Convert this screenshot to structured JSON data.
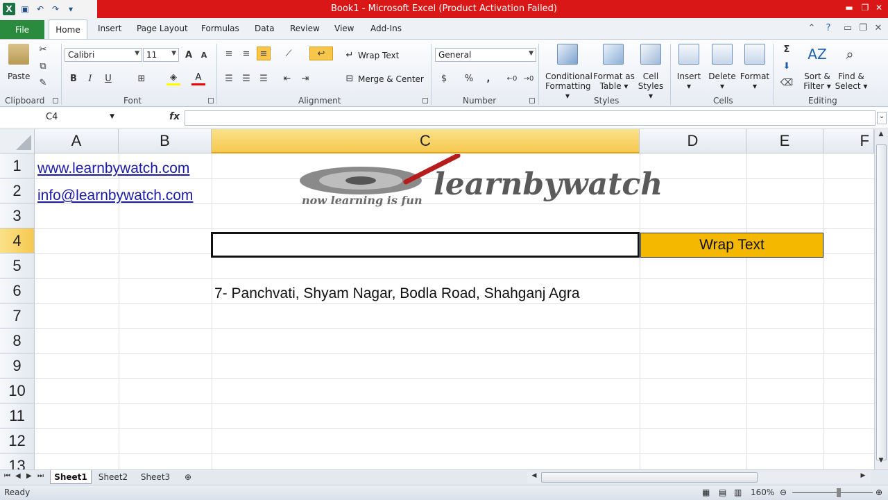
{
  "window": {
    "title": "Book1  -  Microsoft Excel (Product Activation Failed)"
  },
  "qat": {
    "logo": "X",
    "icons": [
      "save-icon",
      "undo-icon",
      "redo-icon",
      "customize-icon"
    ]
  },
  "tabs": {
    "file": "File",
    "home": "Home",
    "insert": "Insert",
    "page_layout": "Page Layout",
    "formulas": "Formulas",
    "data": "Data",
    "review": "Review",
    "view": "View",
    "add_ins": "Add-Ins"
  },
  "ribbon": {
    "clipboard": {
      "paste": "Paste",
      "group": "Clipboard"
    },
    "font": {
      "name": "Calibri",
      "size": "11",
      "group": "Font",
      "bold": "B",
      "italic": "I",
      "underline": "U",
      "grow": "A",
      "shrink": "A"
    },
    "alignment": {
      "wrap_text": "Wrap Text",
      "merge_center": "Merge & Center",
      "group": "Alignment"
    },
    "number": {
      "format": "General",
      "percent": "%",
      "comma": ",",
      "group": "Number"
    },
    "styles": {
      "conditional_1": "Conditional",
      "conditional_2": "Formatting",
      "format_table_1": "Format as",
      "format_table_2": "Table",
      "cell_styles_1": "Cell",
      "cell_styles_2": "Styles",
      "group": "Styles"
    },
    "cells": {
      "insert": "Insert",
      "delete": "Delete",
      "format": "Format",
      "group": "Cells"
    },
    "editing": {
      "sigma": "Σ",
      "sort_1": "Sort &",
      "sort_2": "Filter",
      "find_1": "Find &",
      "find_2": "Select",
      "group": "Editing"
    }
  },
  "formula_bar": {
    "name_box": "C4",
    "fx": "fx",
    "value": ""
  },
  "grid": {
    "columns": [
      "A",
      "B",
      "C",
      "D",
      "E",
      "F"
    ],
    "rows": [
      "1",
      "2",
      "3",
      "4",
      "5",
      "6",
      "7",
      "8",
      "9",
      "10",
      "11",
      "12",
      "13"
    ],
    "a1": "www.learnbywatch.com",
    "a2": "info@learnbywatch.com",
    "d4": "Wrap Text",
    "c6": "7- Panchvati, Shyam Nagar, Bodla Road, Shahganj Agra",
    "logo_text": "learnbywatch",
    "logo_tagline": "now learning is fun"
  },
  "sheets": [
    "Sheet1",
    "Sheet2",
    "Sheet3"
  ],
  "status": {
    "ready": "Ready",
    "zoom": "160%"
  },
  "colors": {
    "title_bar": "#d91717",
    "file_tab": "#2a8a3d",
    "highlight_cell": "#f5b800",
    "active_header": "#f6c94f"
  }
}
